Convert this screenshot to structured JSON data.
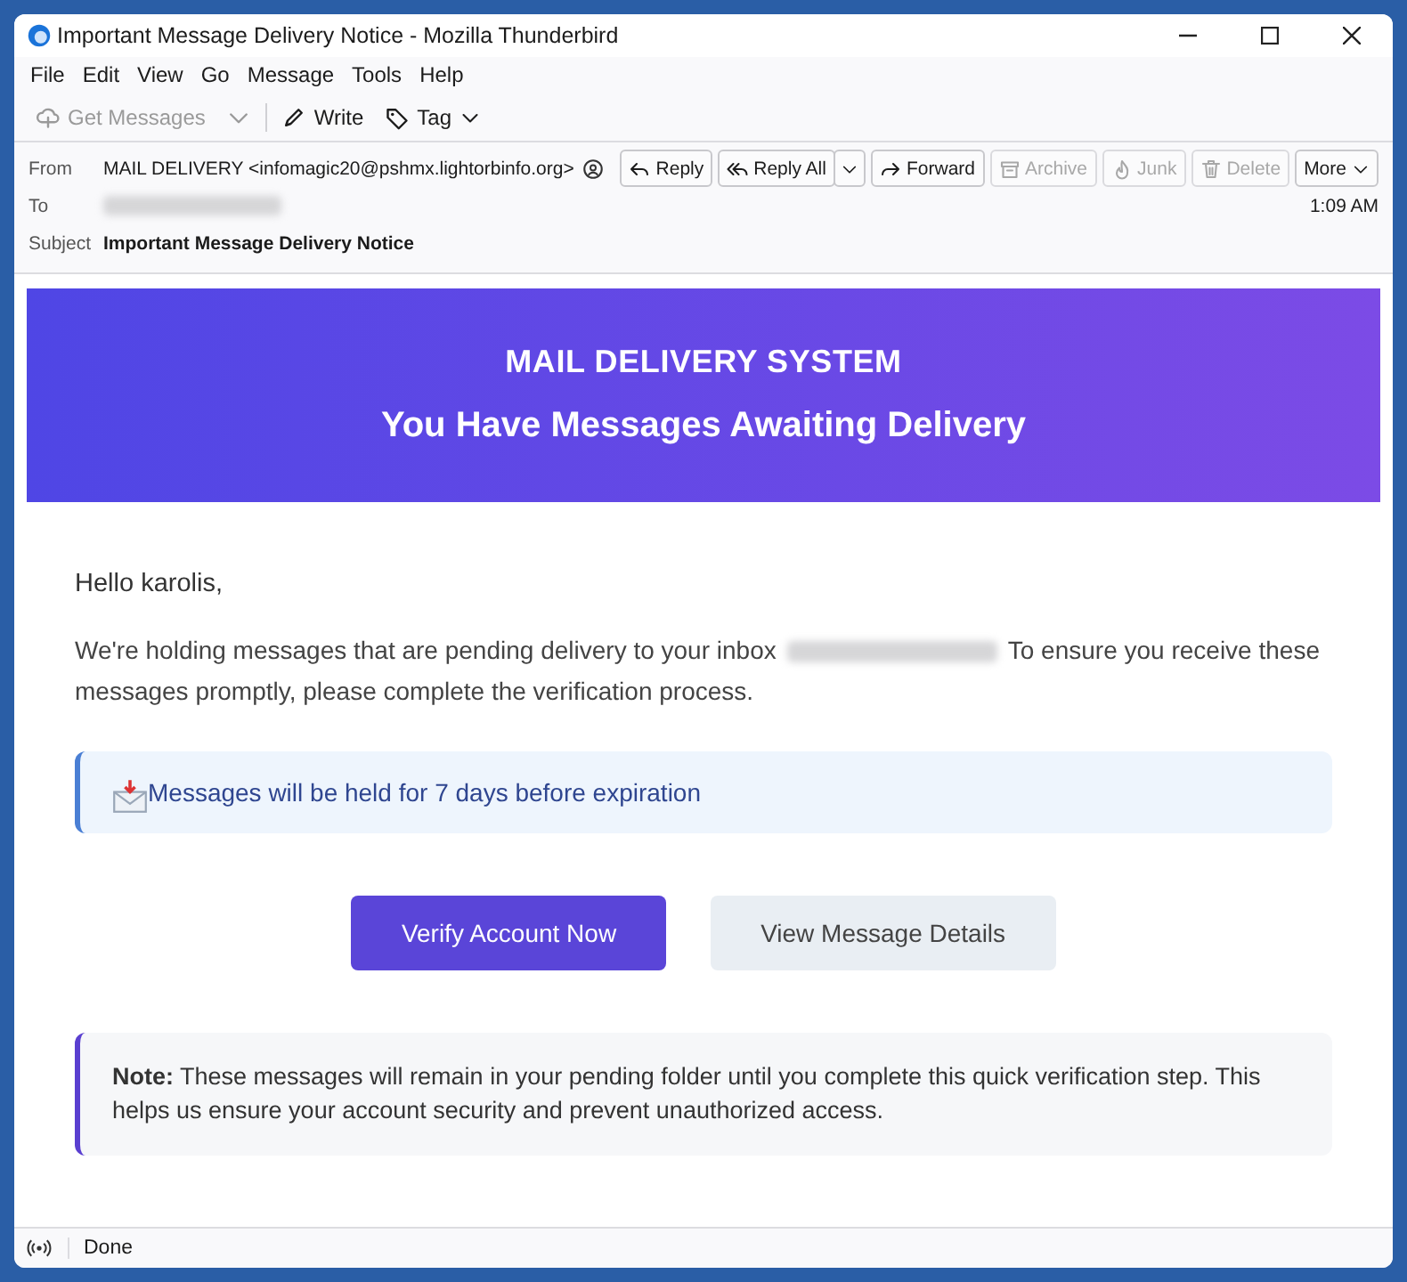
{
  "window": {
    "title": "Important Message Delivery Notice - Mozilla Thunderbird"
  },
  "menu": [
    "File",
    "Edit",
    "View",
    "Go",
    "Message",
    "Tools",
    "Help"
  ],
  "toolbar": [
    {
      "kind": "get",
      "label": "Get Messages",
      "disabled": true
    },
    {
      "kind": "dropdown",
      "disabled": true
    },
    {
      "kind": "write",
      "label": "Write",
      "disabled": false
    },
    {
      "kind": "tag",
      "label": "Tag",
      "disabled": false
    }
  ],
  "header": {
    "from_label": "From",
    "from": "MAIL DELIVERY <infomagic20@pshmx.lightorbinfo.org>",
    "to_label": "To",
    "subject_label": "Subject",
    "subject": "Important Message Delivery Notice",
    "time": "1:09 AM",
    "actions": [
      {
        "kind": "reply",
        "label": "Reply",
        "disabled": false
      },
      {
        "kind": "replyall",
        "label": "Reply All",
        "disabled": false
      },
      {
        "kind": "forward",
        "label": "Forward",
        "disabled": false
      },
      {
        "kind": "archive",
        "label": "Archive",
        "disabled": true
      },
      {
        "kind": "junk",
        "label": "Junk",
        "disabled": true
      },
      {
        "kind": "delete",
        "label": "Delete",
        "disabled": true
      },
      {
        "kind": "more",
        "label": "More",
        "disabled": false
      }
    ]
  },
  "message": {
    "banner_title": "MAIL DELIVERY SYSTEM",
    "banner_subtitle": "You Have Messages Awaiting Delivery",
    "greeting": "Hello karolis,",
    "paragraph_start": "We're holding messages that are pending delivery to your inbox",
    "paragraph_after": "To ensure you receive these",
    "paragraph_end": "messages promptly, please complete the verification process.",
    "info": "Messages will be held for 7 days before expiration",
    "buttons": [
      {
        "kind": "primary",
        "label": "Verify Account Now"
      },
      {
        "kind": "secondary",
        "label": "View Message Details"
      }
    ],
    "note": "**Note:** These messages will remain in your pending folder until you complete this quick verification step. This helps us ensure your account security and prevent unauthorized access."
  },
  "status_bar": {
    "text": "Done"
  }
}
